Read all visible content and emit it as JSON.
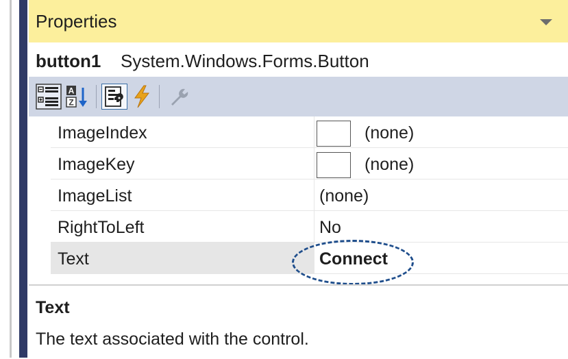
{
  "window": {
    "title": "Properties"
  },
  "object": {
    "name": "button1",
    "type": "System.Windows.Forms.Button"
  },
  "toolbar": {
    "buttons": [
      {
        "icon": "categorized-icon"
      },
      {
        "icon": "alphabetical-icon"
      },
      {
        "icon": "properties-icon"
      },
      {
        "icon": "events-icon"
      },
      {
        "icon": "property-pages-icon"
      }
    ]
  },
  "properties": [
    {
      "name": "ImageIndex",
      "value": "(none)",
      "has_swatch": true
    },
    {
      "name": "ImageKey",
      "value": "(none)",
      "has_swatch": true
    },
    {
      "name": "ImageList",
      "value": "(none)"
    },
    {
      "name": "RightToLeft",
      "value": "No"
    },
    {
      "name": "Text",
      "value": "Connect",
      "selected": true,
      "bold": true
    }
  ],
  "description": {
    "title": "Text",
    "text": "The text associated with the control."
  },
  "colors": {
    "titlebar_bg": "#fcef9c",
    "toolbar_bg": "#cfd6e5",
    "accent_navy": "#2f3a66",
    "annotation": "#1f4e8c"
  }
}
